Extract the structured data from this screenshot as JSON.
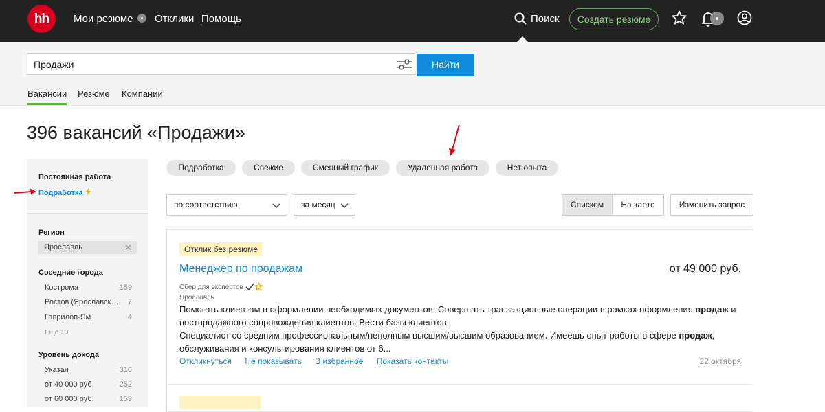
{
  "header": {
    "logo": "hh",
    "nav": {
      "resumes": "Мои резюме",
      "responses": "Отклики",
      "help": "Помощь"
    },
    "search_label": "Поиск",
    "create_resume": "Создать резюме"
  },
  "search": {
    "query": "Продажи",
    "find_button": "Найти",
    "tabs": [
      "Вакансии",
      "Резюме",
      "Компании"
    ]
  },
  "page_title": "396 вакансий «Продажи»",
  "sidebar": {
    "employment_heading": "Постоянная работа",
    "employment_link": "Подработка",
    "region_heading": "Регион",
    "region_value": "Ярославль",
    "neighbor_heading": "Соседние города",
    "neighbors": [
      {
        "label": "Кострома",
        "count": "159"
      },
      {
        "label": "Ростов (Ярославская область)",
        "count": "7"
      },
      {
        "label": "Гаврилов-Ям",
        "count": "4"
      }
    ],
    "neighbors_more": "Еще 10",
    "income_heading": "Уровень дохода",
    "income": [
      {
        "label": "Указан",
        "count": "316"
      },
      {
        "label": "от 40 000 руб.",
        "count": "252"
      },
      {
        "label": "от 60 000 руб.",
        "count": "159"
      }
    ]
  },
  "chips": [
    "Подработка",
    "Свежие",
    "Сменный график",
    "Удаленная работа",
    "Нет опыта"
  ],
  "controls": {
    "sort": "по соответствию",
    "period": "за месяц",
    "view_list": "Списком",
    "view_map": "На карте",
    "edit_query": "Изменить запрос"
  },
  "vacancy": {
    "badge": "Отклик без резюме",
    "title": "Менеджер по продажам",
    "salary": "от 49 000 руб.",
    "company": "Сбер для экспертов",
    "city": "Ярославль",
    "desc1_a": "Помогать клиентам в оформлении необходимых документов. Совершать транзакционные операции в рамках оформления ",
    "desc1_b": "продаж",
    "desc1_c": " и постпродажного сопровождения клиентов. Вести базы клиентов.",
    "desc2_a": "Специалист со средним профессиональным/неполным высшим/высшим образованием. Имеешь опыт работы в сфере ",
    "desc2_b": "продаж",
    "desc2_c": ", обслуживания и консультирования клиентов от 6...",
    "actions": [
      "Откликнуться",
      "Не показывать",
      "В избранное",
      "Показать контакты"
    ],
    "date": "22 октября"
  },
  "colors": {
    "brand": "#d6001c",
    "link": "#0f8bdc",
    "accent_green": "#61b040",
    "badge": "#fff3c4",
    "annotation": "#e3000f"
  }
}
